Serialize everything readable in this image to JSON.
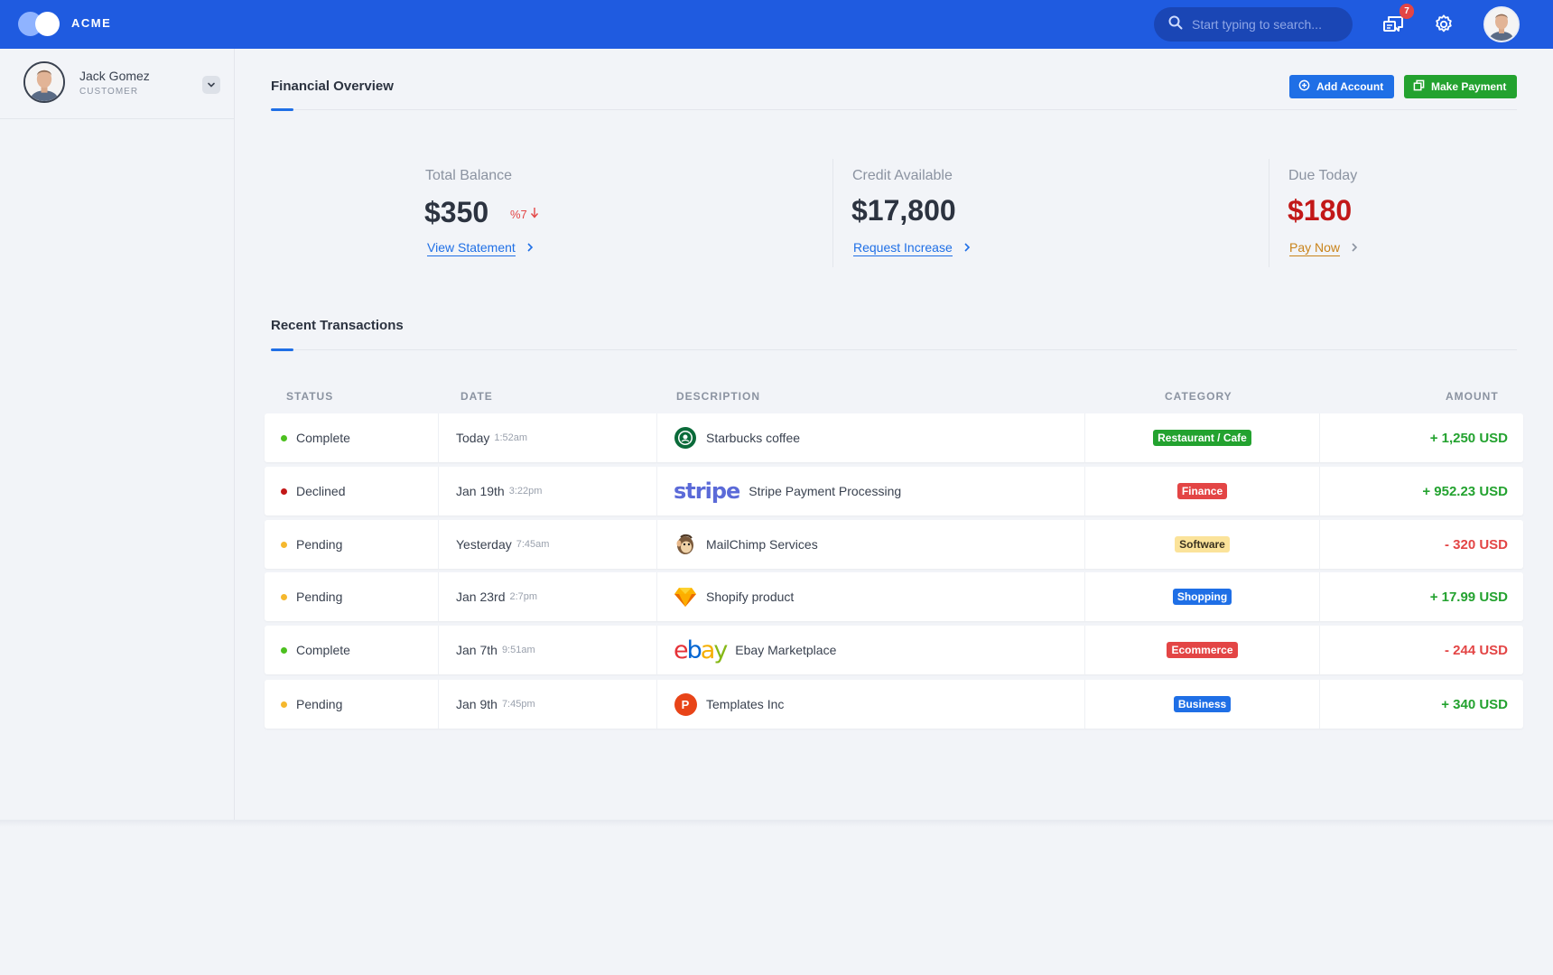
{
  "app": {
    "brand": "ACME"
  },
  "header": {
    "search_placeholder": "Start typing to search...",
    "notification_count": "7"
  },
  "user": {
    "name": "Jack Gomez",
    "role": "CUSTOMER"
  },
  "overview": {
    "title": "Financial Overview",
    "add_account": "Add Account",
    "make_payment": "Make Payment",
    "stats": [
      {
        "label": "Total Balance",
        "value": "$350",
        "trend": "%7",
        "link": "View Statement"
      },
      {
        "label": "Credit Available",
        "value": "$17,800",
        "link": "Request Increase"
      },
      {
        "label": "Due Today",
        "value": "$180",
        "link": "Pay Now"
      }
    ]
  },
  "transactions": {
    "title": "Recent Transactions",
    "columns": {
      "status": "STATUS",
      "date": "DATE",
      "description": "DESCRIPTION",
      "category": "CATEGORY",
      "amount": "AMOUNT"
    },
    "rows": [
      {
        "status": "Complete",
        "status_color": "#4cc01f",
        "date": "Today",
        "time": "1:52am",
        "logo": "starbucks-logo",
        "description": "Starbucks coffee",
        "category": "Restaurant / Cafe",
        "category_color": "#23a22f",
        "amount": "+ 1,250 USD",
        "amount_color": "#23a22f"
      },
      {
        "status": "Declined",
        "status_color": "#c21818",
        "date": "Jan 19th",
        "time": "3:22pm",
        "logo": "stripe-logo",
        "logo_text": "stripe",
        "description": "Stripe Payment Processing",
        "category": "Finance",
        "category_color": "#e34545",
        "amount": "+ 952.23 USD",
        "amount_color": "#23a22f"
      },
      {
        "status": "Pending",
        "status_color": "#f5b82e",
        "date": "Yesterday",
        "time": "7:45am",
        "logo": "mailchimp-logo",
        "description": "MailChimp Services",
        "category": "Software",
        "category_color": "#fbe39a",
        "amount": "- 320 USD",
        "amount_color": "#e34545"
      },
      {
        "status": "Pending",
        "status_color": "#f5b82e",
        "date": "Jan 23rd",
        "time": "2:7pm",
        "logo": "sketch-logo",
        "description": "Shopify product",
        "category": "Shopping",
        "category_color": "#1f6fe6",
        "amount": "+ 17.99 USD",
        "amount_color": "#23a22f"
      },
      {
        "status": "Complete",
        "status_color": "#4cc01f",
        "date": "Jan 7th",
        "time": "9:51am",
        "logo": "ebay-logo",
        "logo_text": "ebay",
        "description": "Ebay Marketplace",
        "category": "Ecommerce",
        "category_color": "#e34545",
        "amount": "- 244 USD",
        "amount_color": "#e34545"
      },
      {
        "status": "Pending",
        "status_color": "#f5b82e",
        "date": "Jan 9th",
        "time": "7:45pm",
        "logo": "templates-logo",
        "logo_text": "P",
        "description": "Templates Inc",
        "category": "Business",
        "category_color": "#1f6fe6",
        "amount": "+ 340 USD",
        "amount_color": "#23a22f"
      }
    ]
  }
}
